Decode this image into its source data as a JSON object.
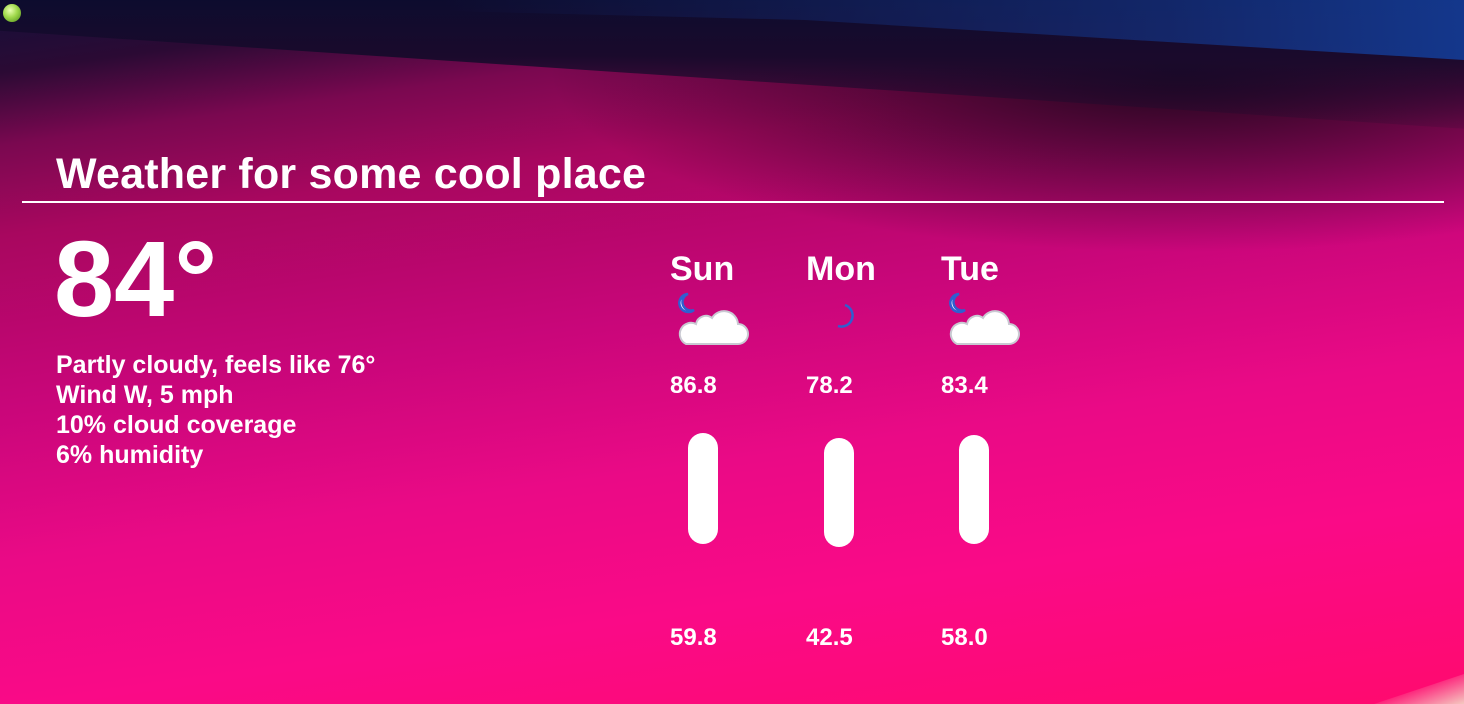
{
  "title": "Weather for some cool place",
  "current": {
    "temperature": "84°",
    "conditions": "Partly cloudy, feels like 76°",
    "wind": "Wind W, 5 mph",
    "cloud_coverage": "10% cloud coverage",
    "humidity": "6% humidity"
  },
  "forecast": [
    {
      "day": "Sun",
      "icon": "moon-cloud-icon",
      "high": "86.8",
      "low": "59.8",
      "high_value": 86.8,
      "low_value": 59.8
    },
    {
      "day": "Mon",
      "icon": "moon-icon",
      "high": "78.2",
      "low": "42.5",
      "high_value": 78.2,
      "low_value": 42.5
    },
    {
      "day": "Tue",
      "icon": "moon-cloud-icon",
      "high": "83.4",
      "low": "58.0",
      "high_value": 83.4,
      "low_value": 58.0
    }
  ],
  "colors": {
    "background_top": "#14103a",
    "background_mid": "#c9067a",
    "background_bottom": "#fa0a87",
    "text": "#ffffff",
    "moon": "#2f5fd0"
  }
}
